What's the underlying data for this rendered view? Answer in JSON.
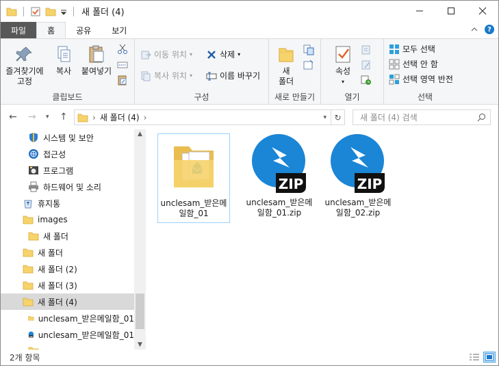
{
  "window": {
    "title": "새 폴더 (4)",
    "quick_access": [
      "folder-icon",
      "properties-check-icon",
      "new-folder-icon",
      "dropdown-arrow-icon"
    ],
    "buttons": [
      "minimize",
      "maximize",
      "close"
    ]
  },
  "ribbon_tabs": [
    {
      "label": "파일",
      "state": "file"
    },
    {
      "label": "홈",
      "state": "active"
    },
    {
      "label": "공유",
      "state": "normal"
    },
    {
      "label": "보기",
      "state": "normal"
    }
  ],
  "ribbon": {
    "clipboard": {
      "group_label": "클립보드",
      "pin": "즐겨찾기에 고정",
      "copy": "복사",
      "paste": "붙여넣기"
    },
    "organize": {
      "group_label": "구성",
      "move_to": "이동 위치",
      "copy_to": "복사 위치",
      "delete": "삭제",
      "rename": "이름 바꾸기"
    },
    "new": {
      "group_label": "새로 만들기",
      "new_folder": "새 폴더"
    },
    "open": {
      "group_label": "열기",
      "properties": "속성"
    },
    "select": {
      "group_label": "선택",
      "select_all": "모두 선택",
      "select_none": "선택 안 함",
      "invert": "선택 영역 반전"
    }
  },
  "address": {
    "path": [
      "새 폴더 (4)"
    ],
    "search_placeholder": "새 폴더 (4) 검색"
  },
  "nav_pane": {
    "items": [
      {
        "label": "시스템 및 보안",
        "icon": "shield-icon"
      },
      {
        "label": "접근성",
        "icon": "accessibility-icon"
      },
      {
        "label": "프로그램",
        "icon": "programs-icon"
      },
      {
        "label": "하드웨어 및 소리",
        "icon": "printer-icon"
      },
      {
        "label": "휴지통",
        "icon": "recycle-bin-icon"
      },
      {
        "label": "images",
        "icon": "folder-icon"
      },
      {
        "label": "새 폴더",
        "icon": "folder-icon"
      },
      {
        "label": "새 폴더",
        "icon": "folder-icon"
      },
      {
        "label": "새 폴더 (2)",
        "icon": "folder-icon"
      },
      {
        "label": "새 폴더 (3)",
        "icon": "folder-icon"
      },
      {
        "label": "새 폴더 (4)",
        "icon": "folder-icon",
        "selected": true
      },
      {
        "label": "unclesam_받은메일함_01",
        "icon": "folder-icon"
      },
      {
        "label": "unclesam_받은메일함_01",
        "icon": "zip-icon"
      },
      {
        "label": "",
        "icon": "folder-icon"
      }
    ]
  },
  "files": [
    {
      "name": "unclesam_받은메일함_01",
      "type": "folder",
      "selected": true
    },
    {
      "name": "unclesam_받은메일함_01.zip",
      "type": "zip"
    },
    {
      "name": "unclesam_받은메일함_02.zip",
      "type": "zip"
    }
  ],
  "status": {
    "count": "2개 항목"
  },
  "colors": {
    "accent": "#1979ca",
    "zip_blue": "#1b85d6",
    "folder_yellow": "#f6d36b",
    "selection": "#cce8ff"
  }
}
